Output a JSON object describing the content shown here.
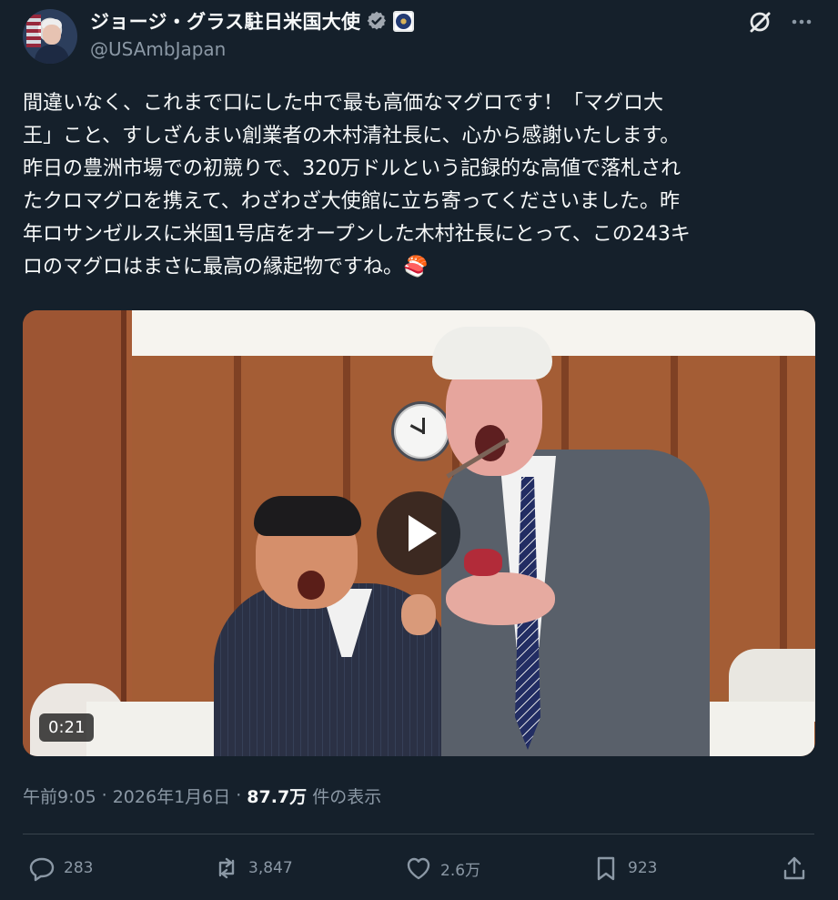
{
  "account": {
    "name": "ジョージ・グラス駐日米国大使",
    "handle": "@USAmbJapan"
  },
  "post": {
    "text": "間違いなく、これまで口にした中で最も高価なマグロです！「マグロ大\n王」こと、すしざんまい創業者の木村清社長に、心から感謝いたします。\n昨日の豊洲市場での初競りで、320万ドルという記録的な高値で落札され\nたクロマグロを携えて、わざわざ大使館に立ち寄ってくださいました。昨\n年ロサンゼルスに米国1号店をオープンした木村社長にとって、この243キ\nロのマグロはまさに最高の縁起物ですね。🍣"
  },
  "video": {
    "duration": "0:21"
  },
  "meta": {
    "time": "午前9:05",
    "date": "2026年1月6日",
    "views": "87.7万",
    "views_label": "件の表示"
  },
  "actions": {
    "replies": "283",
    "reposts": "3,847",
    "likes": "2.6万",
    "bookmarks": "923"
  },
  "colors": {
    "background": "#15202b",
    "text": "#f7f9f9",
    "secondary": "#8b98a5",
    "verified": "#a0a7b0"
  },
  "icons": {
    "verified": "verified-badge-icon",
    "government": "government-seal-icon",
    "grok": "grok-icon",
    "more": "more-icon",
    "reply": "reply-icon",
    "repost": "repost-icon",
    "like": "heart-icon",
    "bookmark": "bookmark-icon",
    "share": "share-icon",
    "play": "play-icon"
  }
}
